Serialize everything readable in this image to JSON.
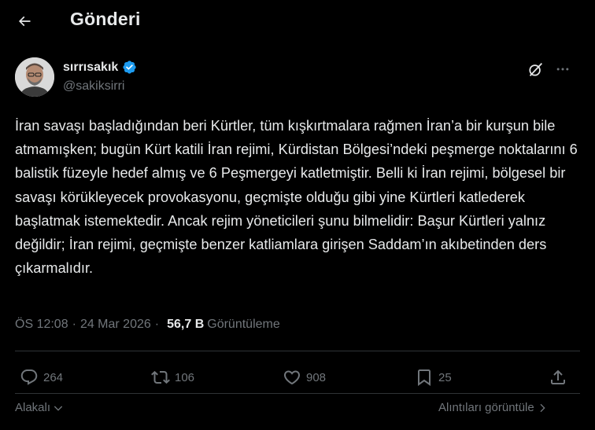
{
  "header": {
    "title": "Gönderi",
    "back_icon": "arrow-left-icon"
  },
  "author": {
    "display_name": "sırrısakık",
    "handle": "@sakiksirri",
    "verified": true,
    "verified_color": "#1d9bf0"
  },
  "tweet": {
    "text": "İran savaşı başladığından beri Kürtler, tüm kışkırtmalara rağmen İran’a bir kurşun bile atmamışken; bugün Kürt katili İran rejimi, Kürdistan Bölgesi’ndeki peşmerge noktalarını 6 balistik füzeyle hedef almış ve 6 Peşmergeyi katletmiştir. Belli ki İran rejimi, bölgesel bir savaşı körükleyecek provokasyonu, geçmişte olduğu gibi yine Kürtleri katlederek başlatmak istemektedir. Ancak rejim yöneticileri şunu bilmelidir: Başur Kürtleri yalnız değildir; İran rejimi, geçmişte benzer katliamlara girişen Saddam’ın akıbetinden ders çıkarmalıdır.",
    "time": "ÖS 12:08",
    "separator": "·",
    "date": "24 Mar 2026",
    "views": "56,7 B",
    "views_label": "Görüntüleme"
  },
  "actions": {
    "replies": "264",
    "reposts": "106",
    "likes": "908",
    "bookmarks": "25"
  },
  "footer": {
    "relevant_label": "Alakalı",
    "quotes_label": "Alıntıları görüntüle"
  },
  "colors": {
    "background": "#000000",
    "text": "#e7e9ea",
    "muted": "#71767b",
    "accent": "#1d9bf0"
  }
}
